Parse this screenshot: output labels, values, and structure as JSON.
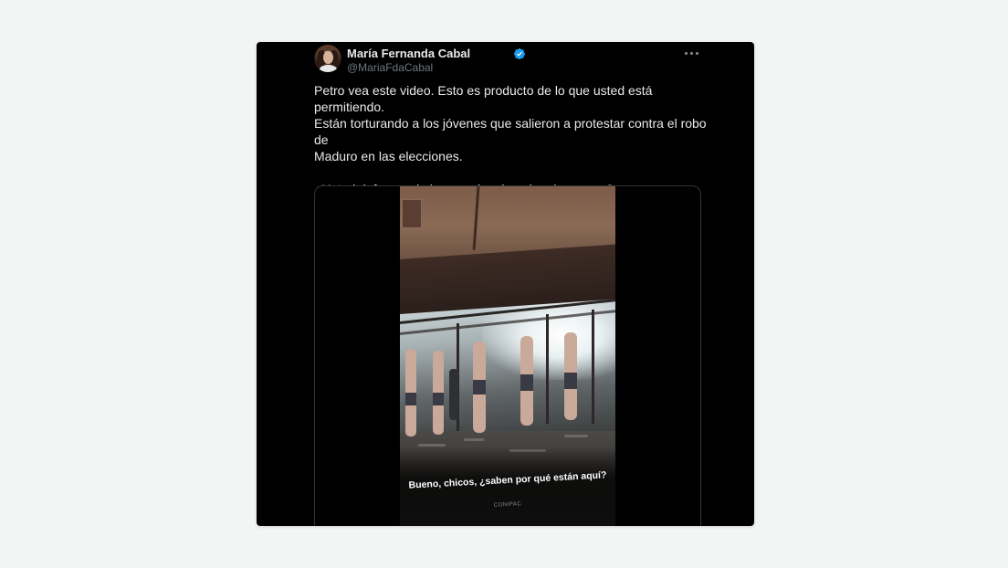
{
  "tweet": {
    "author": {
      "display_name": "María Fernanda Cabal",
      "handle": "@MariaFdaCabal",
      "verified": true,
      "verified_color": "#1d9bf0"
    },
    "text_paragraph_1": "Petro vea este video. Esto es producto de lo que usted está permitiendo.\nEstán torturando a los jóvenes que salieron a protestar contra el robo de\nMaduro en las elecciones.",
    "text_paragraph_2": "¿Usted defensor de la paz y los derechos humanos?",
    "media": {
      "type": "video",
      "subtitle": "Bueno, chicos, ¿saben por qué están aquí?",
      "watermark": "CONIPAC"
    }
  },
  "icons": {
    "more": "more-horizontal-icon",
    "verified": "verified-badge-icon"
  },
  "colors": {
    "page_background": "#f3f4f4",
    "card_background": "#000000",
    "primary_text": "#e7e9ea",
    "secondary_text": "#71767b",
    "media_border": "#2f3336"
  }
}
